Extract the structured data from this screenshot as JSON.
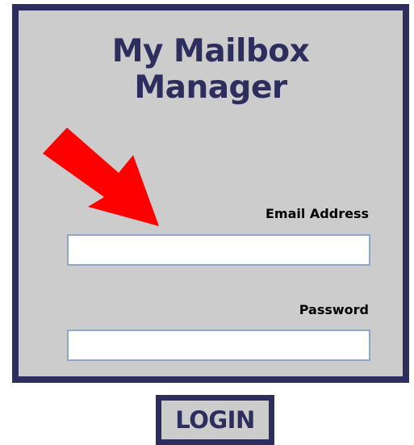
{
  "app": {
    "title_line1": "My Mailbox",
    "title_line2": "Manager"
  },
  "form": {
    "email_label": "Email Address",
    "email_value": "",
    "password_label": "Password",
    "password_value": ""
  },
  "actions": {
    "login_label": "LOGIN"
  },
  "annotation": {
    "icon": "red-arrow-icon",
    "color": "#ff0000"
  },
  "colors": {
    "frame": "#2e2e5e",
    "panel": "#cccccc",
    "input_border": "#8fa6c8"
  }
}
